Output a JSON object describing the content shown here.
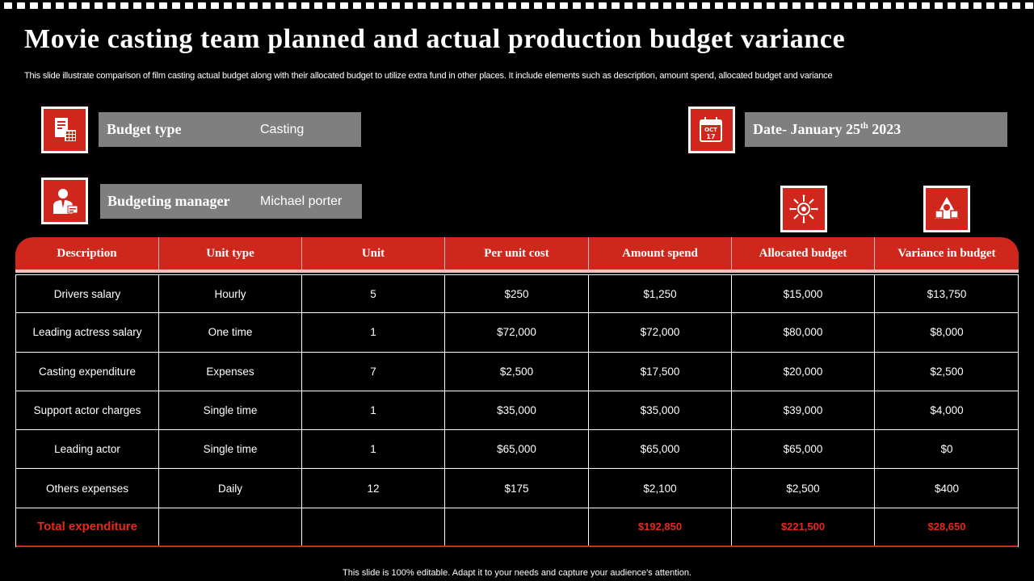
{
  "title": "Movie casting team planned and actual production budget variance",
  "subtitle": "This slide illustrate comparison of film casting actual budget along with their allocated budget to utilize extra fund in other places. It include elements such as description, amount spend, allocated budget and variance",
  "budget_type": {
    "label": "Budget type",
    "value": "Casting",
    "icon": "budget-document-icon"
  },
  "budgeting_manager": {
    "label": "Budgeting manager",
    "value": "Michael porter",
    "icon": "manager-person-icon"
  },
  "date": {
    "prefix": "Date- January 25",
    "suffix": "th",
    "year": " 2023",
    "icon": "calendar-icon",
    "icon_month": "OCT",
    "icon_day": "17"
  },
  "header_icons": {
    "allocated": "target-arrows-icon",
    "variance": "triangle-cubes-icon"
  },
  "table": {
    "headers": [
      "Description",
      "Unit type",
      "Unit",
      "Per unit cost",
      "Amount  spend",
      "Allocated budget",
      "Variance  in budget"
    ],
    "rows": [
      [
        "Drivers  salary",
        "Hourly",
        "5",
        "$250",
        "$1,250",
        "$15,000",
        "$13,750"
      ],
      [
        "Leading  actress salary",
        "One time",
        "1",
        "$72,000",
        "$72,000",
        "$80,000",
        "$8,000"
      ],
      [
        "Casting  expenditure",
        "Expenses",
        "7",
        "$2,500",
        "$17,500",
        "$20,000",
        "$2,500"
      ],
      [
        "Support  actor charges",
        "Single time",
        "1",
        "$35,000",
        "$35,000",
        "$39,000",
        "$4,000"
      ],
      [
        "Leading  actor",
        "Single time",
        "1",
        "$65,000",
        "$65,000",
        "$65,000",
        "$0"
      ],
      [
        "Others expenses",
        "Daily",
        "12",
        "$175",
        "$2,100",
        "$2,500",
        "$400"
      ]
    ],
    "total": [
      "Total expenditure",
      "",
      "",
      "",
      "$192,850",
      "$221,500",
      "$28,650"
    ]
  },
  "footer": "This slide is 100% editable.  Adapt it to your needs and capture your audience's attention.",
  "colors": {
    "accent": "#d0271d",
    "bar_gray": "#7f7f7f",
    "background": "#000000",
    "total_text": "#e8271d"
  }
}
